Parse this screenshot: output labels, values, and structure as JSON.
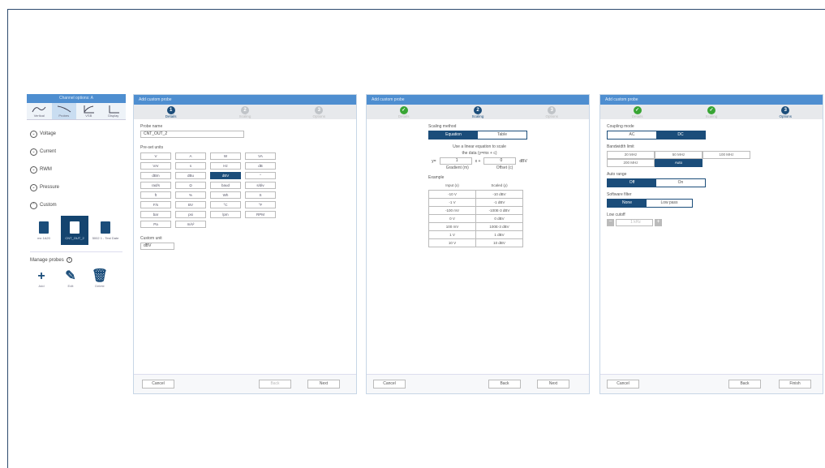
{
  "channel_panel": {
    "title": "Channel options: A",
    "tabs": [
      {
        "label": "Vertical",
        "icon": "vertical-wave-icon"
      },
      {
        "label": "Probes",
        "icon": "probe-curve-icon"
      },
      {
        "label": "VSB",
        "icon": "vsb-icon"
      },
      {
        "label": "Display",
        "icon": "display-icon"
      }
    ],
    "categories": [
      "Voltage",
      "Current",
      "RWM",
      "Pressure",
      "Custom"
    ],
    "probes": [
      {
        "label": "mx 1A20",
        "active": false
      },
      {
        "label": "CNT_OUT_2",
        "active": true
      },
      {
        "label": "5002 1 - Test Date",
        "active": false
      }
    ],
    "manage_label": "Manage probes",
    "actions": [
      "Add",
      "Edit",
      "Delete"
    ]
  },
  "dialog1": {
    "title": "Add custom probe",
    "steps": [
      "Details",
      "Scaling",
      "Options"
    ],
    "probe_name_label": "Probe name",
    "probe_name_value": "CNT_OUT_2",
    "preset_label": "Pre-set units",
    "units": [
      "V",
      "A",
      "W",
      "VA",
      "VAr",
      "s",
      "Hz",
      "dB",
      "dBm",
      "dBu",
      "dBV",
      "°",
      "rad/s",
      "Ω",
      "baud",
      "s/div",
      "ft",
      "%",
      "Wh",
      "S",
      "F/s",
      "BV",
      "°C",
      "°F",
      "bar",
      "psi",
      "lpm",
      "RPM",
      "Pa",
      "m/s²"
    ],
    "custom_unit_label": "Custom unit",
    "custom_unit_value": "dBV",
    "cancel": "Cancel",
    "back": "Back",
    "next": "Next"
  },
  "dialog2": {
    "title": "Add custom probe",
    "steps": [
      "Details",
      "Scaling",
      "Options"
    ],
    "scaling_method_label": "Scaling method",
    "method_options": [
      "Equation",
      "Table"
    ],
    "eq_desc_line1": "Use a linear equation to scale",
    "eq_desc_line2": "the data (y=mx + c)",
    "y_label": "y=",
    "gradient_value": "1",
    "x_plus": "x +",
    "offset_value": "0",
    "unit": "dBV",
    "gradient_caption": "Gradient (m)",
    "offset_caption": "Offset (c)",
    "example_label": "Example",
    "table_headers": [
      "Input (x)",
      "Scaled (y)"
    ],
    "table_rows": [
      [
        "-10 V",
        "-10 dBV"
      ],
      [
        "-1 V",
        "-1 dBV"
      ],
      [
        "-100 mV",
        "-100E-3 dBV"
      ],
      [
        "0 V",
        "0 dBV"
      ],
      [
        "100 mV",
        "100E-3 dBV"
      ],
      [
        "1 V",
        "1 dBV"
      ],
      [
        "10 V",
        "10 dBV"
      ]
    ],
    "cancel": "Cancel",
    "back": "Back",
    "next": "Next"
  },
  "dialog3": {
    "title": "Add custom probe",
    "steps": [
      "Details",
      "Scaling",
      "Options"
    ],
    "coupling_label": "Coupling mode",
    "coupling_options": [
      "AC",
      "DC"
    ],
    "bw_label": "Bandwidth limit",
    "bw_options": [
      "20 MHz",
      "50 MHz",
      "100 MHz",
      "200 MHz",
      "Auto"
    ],
    "autorange_label": "Auto range",
    "autorange_options": [
      "Off",
      "On"
    ],
    "filter_label": "Software filter",
    "filter_options": [
      "None",
      "Low pass"
    ],
    "lowcut_label": "Low cutoff",
    "lowcut_value": "1 kHz",
    "cancel": "Cancel",
    "back": "Back",
    "finish": "Finish"
  }
}
